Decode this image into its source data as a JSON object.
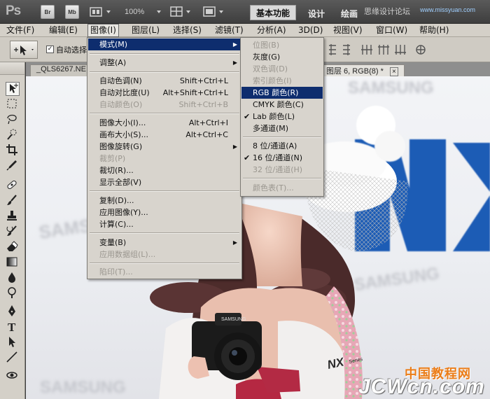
{
  "appbar": {
    "logo": "Ps",
    "bridge_label": "Br",
    "minibridge_label": "Mb",
    "zoom": "100%",
    "workspaces": [
      "基本功能",
      "设计",
      "绘画"
    ],
    "watermark_text": "思缘设计论坛",
    "watermark_url": "www.missyuan.com"
  },
  "menubar": {
    "items": [
      "文件(F)",
      "编辑(E)",
      "图像(I)",
      "图层(L)",
      "选择(S)",
      "滤镜(T)",
      "分析(A)",
      "3D(D)",
      "视图(V)",
      "窗口(W)",
      "帮助(H)"
    ],
    "open_item": "图像(I)"
  },
  "options": {
    "auto_select_label": "自动选择",
    "auto_select_checked": true
  },
  "document": {
    "tabs": [
      "_QLS6267.NE",
      "图层 6, RGB(8) *"
    ],
    "tab_close": "×"
  },
  "image_menu": {
    "items": [
      {
        "label": "模式(M)",
        "shortcut": "",
        "submenu": true,
        "state": "highlighted"
      },
      {
        "sep": true
      },
      {
        "label": "调整(A)",
        "shortcut": "",
        "submenu": true,
        "state": "enabled"
      },
      {
        "sep": true
      },
      {
        "label": "自动色调(N)",
        "shortcut": "Shift+Ctrl+L",
        "state": "enabled"
      },
      {
        "label": "自动对比度(U)",
        "shortcut": "Alt+Shift+Ctrl+L",
        "state": "enabled"
      },
      {
        "label": "自动颜色(O)",
        "shortcut": "Shift+Ctrl+B",
        "state": "disabled"
      },
      {
        "sep": true
      },
      {
        "label": "图像大小(I)...",
        "shortcut": "Alt+Ctrl+I",
        "state": "enabled"
      },
      {
        "label": "画布大小(S)...",
        "shortcut": "Alt+Ctrl+C",
        "state": "enabled"
      },
      {
        "label": "图像旋转(G)",
        "shortcut": "",
        "submenu": true,
        "state": "enabled"
      },
      {
        "label": "裁剪(P)",
        "shortcut": "",
        "state": "disabled"
      },
      {
        "label": "裁切(R)...",
        "shortcut": "",
        "state": "enabled"
      },
      {
        "label": "显示全部(V)",
        "shortcut": "",
        "state": "enabled"
      },
      {
        "sep": true
      },
      {
        "label": "复制(D)...",
        "shortcut": "",
        "state": "enabled"
      },
      {
        "label": "应用图像(Y)...",
        "shortcut": "",
        "state": "enabled"
      },
      {
        "label": "计算(C)...",
        "shortcut": "",
        "state": "enabled"
      },
      {
        "sep": true
      },
      {
        "label": "变量(B)",
        "shortcut": "",
        "submenu": true,
        "state": "enabled"
      },
      {
        "label": "应用数据组(L)...",
        "shortcut": "",
        "state": "disabled"
      },
      {
        "sep": true
      },
      {
        "label": "陷印(T)...",
        "shortcut": "",
        "state": "disabled"
      }
    ]
  },
  "mode_menu": {
    "items": [
      {
        "label": "位图(B)",
        "state": "disabled"
      },
      {
        "label": "灰度(G)",
        "state": "enabled"
      },
      {
        "label": "双色调(D)",
        "state": "disabled"
      },
      {
        "label": "索引颜色(I)",
        "state": "disabled"
      },
      {
        "label": "RGB 颜色(R)",
        "state": "highlighted"
      },
      {
        "label": "CMYK 颜色(C)",
        "state": "enabled"
      },
      {
        "label": "Lab 颜色(L)",
        "state": "enabled",
        "checked": true
      },
      {
        "label": "多通道(M)",
        "state": "enabled"
      },
      {
        "sep": true
      },
      {
        "label": "8 位/通道(A)",
        "state": "enabled"
      },
      {
        "label": "16 位/通道(N)",
        "state": "enabled",
        "checked": true
      },
      {
        "label": "32 位/通道(H)",
        "state": "disabled"
      },
      {
        "sep": true
      },
      {
        "label": "颜色表(T)...",
        "state": "disabled"
      }
    ]
  },
  "canvas_text": {
    "brand": "SAMSUNG",
    "camera_brand": "SAMSUNG",
    "tattoo": "NX",
    "tattoo_sub": "Series"
  },
  "watermark": {
    "cn": "中国教程网",
    "url": "JCWcn.com"
  },
  "colors": {
    "menu_highlight": "#0e2d6e",
    "nx_blue": "#1f5bb5",
    "watermark_orange": "#eb7d18"
  }
}
